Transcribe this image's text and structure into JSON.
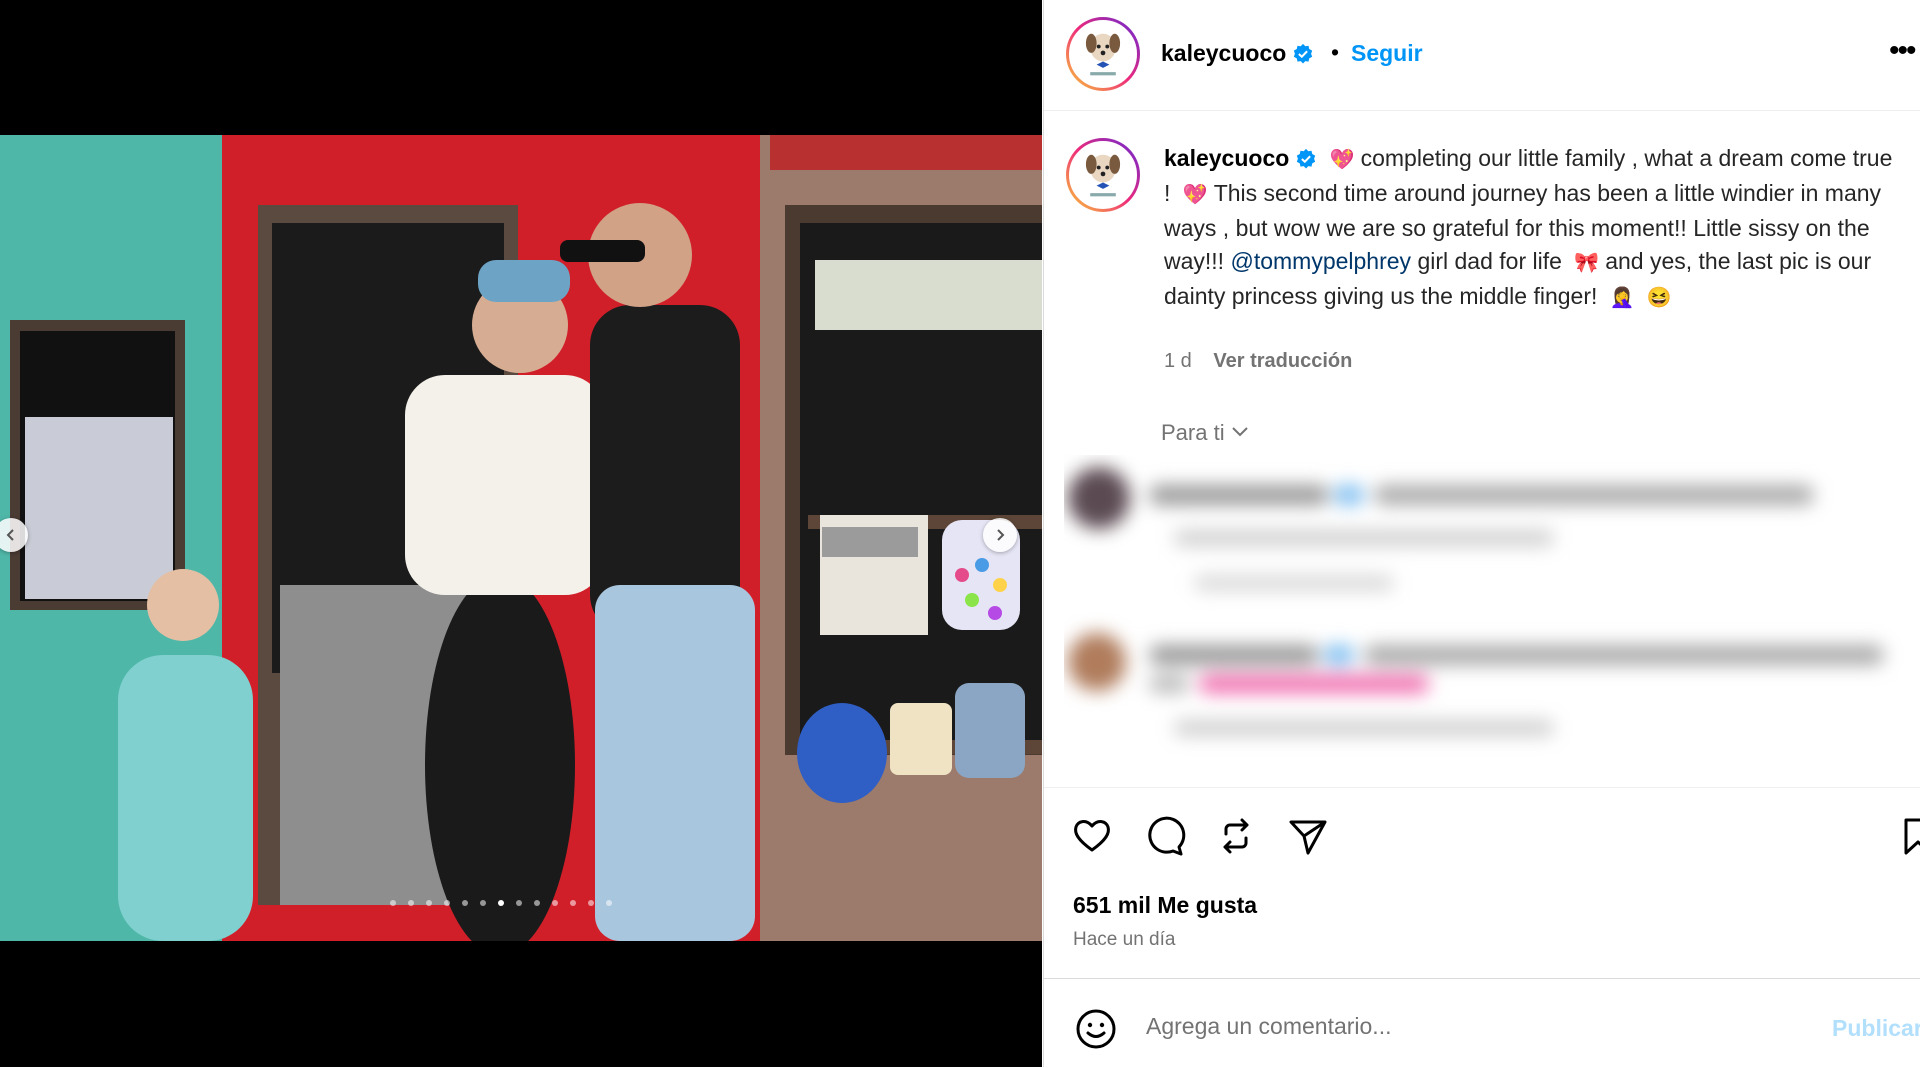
{
  "post": {
    "username": "kaleycuoco",
    "separator": "•",
    "follow_label": "Seguir",
    "more_label": "•••"
  },
  "caption": {
    "username": "kaleycuoco",
    "part1": "completing our little family , what a dream come true !",
    "part2": "This second time around journey has been a little windier in many ways , but wow we are so grateful for this moment!! Little sissy on the way!!!",
    "mention": "@tommypelphrey",
    "part3": "girl dad for life",
    "part4": "and yes, the last pic is our dainty princess giving us the middle finger!",
    "emoji_heart": "💖",
    "emoji_bow": "🎀",
    "emoji_person": "🤦‍♀️",
    "emoji_laugh": "😆",
    "age": "1 d",
    "translate_label": "Ver traducción"
  },
  "comments": {
    "sort_label": "Para ti"
  },
  "carousel": {
    "total": 13,
    "current": 7
  },
  "stats": {
    "likes": "651 mil Me gusta",
    "time": "Hace un día"
  },
  "comment_box": {
    "placeholder": "Agrega un comentario...",
    "publish_label": "Publicar"
  },
  "colors": {
    "accent": "#0095f6",
    "mention": "#00376b",
    "muted": "#737373"
  },
  "icons": [
    "verified-badge-icon",
    "chevron-left-icon",
    "chevron-right-icon",
    "chevron-down-icon",
    "heart-icon",
    "comment-icon",
    "repost-icon",
    "share-icon",
    "bookmark-icon",
    "emoji-icon"
  ]
}
